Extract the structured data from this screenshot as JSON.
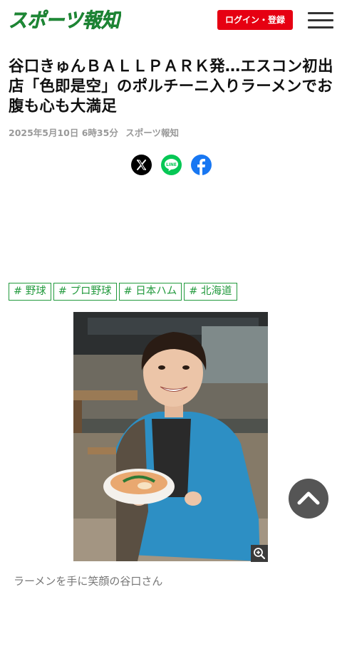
{
  "header": {
    "logo_text": "スポーツ報知",
    "login_label": "ログイン・登録",
    "menu_icon": "hamburger-icon"
  },
  "article": {
    "title": "谷口きゅんＢＡＬＬＰＡＲＫ発…エスコン初出店「色即是空」のポルチーニ入りラーメンでお腹も心も大満足",
    "date": "2025年5月10日 6時35分",
    "source": "スポーツ報知"
  },
  "share": {
    "icons": [
      "x-icon",
      "line-icon",
      "facebook-icon"
    ],
    "line_label": "LINE"
  },
  "tags": [
    "# 野球",
    "# プロ野球",
    "# 日本ハム",
    "# 北海道"
  ],
  "photo": {
    "caption": "ラーメンを手に笑顔の谷口さん",
    "zoom_icon": "zoom-in-icon"
  },
  "scroll_top_icon": "chevron-up-icon",
  "colors": {
    "brand_green": "#229a3d",
    "login_red": "#e60012",
    "x": "#000000",
    "line": "#06c755",
    "facebook": "#1877f2"
  }
}
